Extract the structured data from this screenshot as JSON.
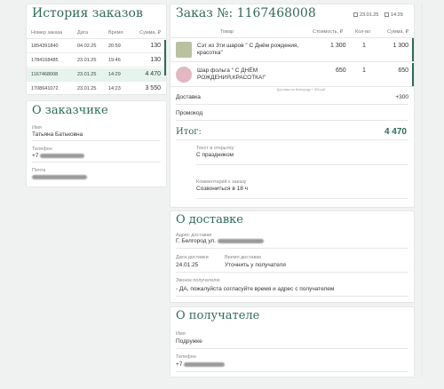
{
  "history": {
    "title": "История заказов",
    "columns": [
      "Номер заказа",
      "Дата",
      "Время",
      "Сумма, ₽"
    ],
    "rows": [
      {
        "number": "1854391840",
        "date": "04.02.25",
        "time": "20:59",
        "sum": "130"
      },
      {
        "number": "1784168485",
        "date": "23.01.25",
        "time": "19:46",
        "sum": "130"
      },
      {
        "number": "1167468008",
        "date": "23.01.25",
        "time": "14:29",
        "sum": "4 470"
      },
      {
        "number": "1708641072",
        "date": "23.01.25",
        "time": "14:23",
        "sum": "3 550"
      }
    ]
  },
  "customer": {
    "title": "О заказчике",
    "name_label": "Имя",
    "name_value": "Татьяна Батькoвна",
    "phone_label": "Телефон",
    "phone_prefix": "+7",
    "email_label": "Почта"
  },
  "order": {
    "title": "Заказ №: 1167468008",
    "date": "23.01.25",
    "time": "14:29",
    "columns": {
      "product": "Товар",
      "price": "Стоимость, ₽",
      "qty": "Кол-во",
      "sum": "Сумма, ₽"
    },
    "items": [
      {
        "name": "Сэт из 3ти шаров \" С Днём рождения, красотка\"",
        "price": "1 300",
        "qty": "1",
        "sum": "1 300",
        "thumb_color": "#b9c2a0"
      },
      {
        "name": "Шар фольга \" С ДНЁМ РОЖДЕНИЯ,КРАСОТКА!\"",
        "price": "650",
        "qty": "1",
        "sum": "650",
        "thumb_color": "#e3b8c0"
      }
    ],
    "delivery_note": "Доставка по Белгороду + 300 руб.",
    "delivery_label": "Доставка",
    "delivery_value": "+300",
    "promo_label": "Промокод",
    "total_label": "Итог:",
    "total_value": "4 470",
    "card_text_label": "Текст в открытку",
    "card_text_value": "С праздником",
    "comment_label": "Комментарий к заказу",
    "comment_value": "Созвониться в 18 ч"
  },
  "delivery": {
    "title": "О доставке",
    "address_label": "Адрес доставки",
    "address_value": "Г. Белгород ул.",
    "date_label": "Дата доставки",
    "date_value": "24.01.25",
    "time_label": "Время доставки",
    "time_value": "Уточнить у получателя",
    "call_label": "Звонок получателю",
    "call_value": "- ДА, пожалуйста согласуйте время и адрес с получателем"
  },
  "recipient": {
    "title": "О получателе",
    "name_label": "Имя",
    "name_value": "Подружке",
    "phone_label": "Телефон",
    "phone_prefix": "+7"
  },
  "colors": {
    "accent": "#2f6b58",
    "active_row": "#e6f4ee",
    "background": "#f0f2f1"
  }
}
